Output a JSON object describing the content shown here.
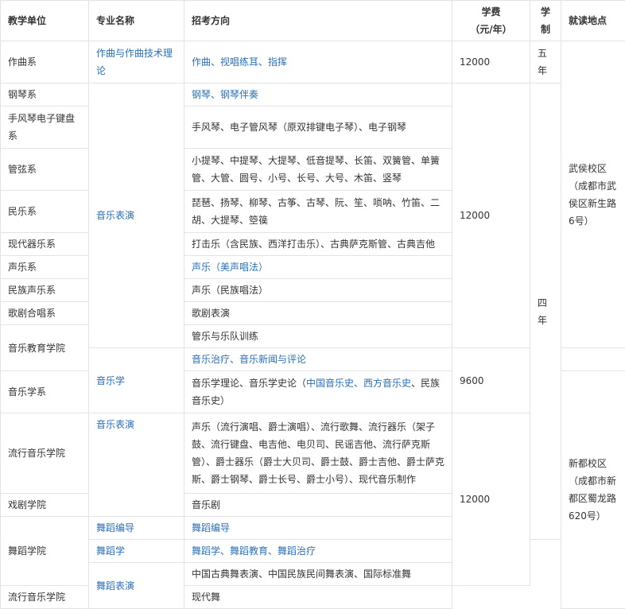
{
  "table": {
    "headers": {
      "unit": "教学单位",
      "major": "专业名称",
      "direction": "招考方向",
      "fee_line1": "学费",
      "fee_line2": "（元/年）",
      "duration_line1": "学",
      "duration_line2": "制",
      "location": "就读地点"
    },
    "units": {
      "composition": "作曲系",
      "piano": "钢琴系",
      "accordion": "手风琴电子键盘系",
      "orchestral": "管弦系",
      "folk": "民乐系",
      "modern_instruments": "现代器乐系",
      "vocal": "声乐系",
      "folk_vocal": "民族声乐系",
      "opera_chorus": "歌剧合唱系",
      "music_education": "音乐教育学院",
      "musicology": "音乐学系",
      "pop_music_1": "流行音乐学院",
      "drama": "戏剧学院",
      "dance": "舞蹈学院",
      "pop_music_2": "流行音乐学院"
    },
    "majors": {
      "composition_theory": "作曲与作曲技术理论",
      "performance_1": "音乐表演",
      "musicology": "音乐学",
      "performance_2": "音乐表演",
      "choreography": "舞蹈编导",
      "dance_studies": "舞蹈学",
      "dance_performance": "舞蹈表演"
    },
    "directions": {
      "composition": "作曲、视唱练耳、指挥",
      "piano": "钢琴、钢琴伴奏",
      "accordion": "手风琴、电子管风琴（原双排键电子琴）、电子钢琴",
      "orchestral": "小提琴、中提琴、大提琴、低音提琴、长笛、双簧管、单簧管、大管、圆号、小号、长号、大号、木笛、竖琴",
      "folk": "琵琶、扬琴、柳琴、古筝、古琴、阮、笙、唢呐、竹笛、二胡、大提琴、箜篌",
      "modern_instruments": "打击乐（含民族、西洋打击乐）、古典萨克斯管、古典吉他",
      "vocal": "声乐（美声唱法）",
      "folk_vocal": "声乐（民族唱法）",
      "opera": "歌剧表演",
      "band_training": "管乐与乐队训练",
      "therapy_news": "音乐治疗、音乐新闻与评论",
      "musicology_prefix": "音乐学理论、音乐学史论（",
      "musicology_link": "中国音乐史、西方音乐史",
      "musicology_suffix": "、民族音乐史）",
      "pop_music": "声乐（流行演唱、爵士演唱）、流行歌舞、流行器乐（架子鼓、流行键盘、电吉他、电贝司、民谣吉他、流行萨克斯管）、爵士器乐（爵士大贝司、爵士鼓、爵士吉他、爵士萨克斯、爵士钢琴、爵士长号、爵士小号）、现代音乐制作",
      "musical": "音乐剧",
      "choreography": "舞蹈编导",
      "dance_studies": "舞蹈学、舞蹈教育、舞蹈治疗",
      "dance_performance": "中国古典舞表演、中国民族民间舞表演、国际标准舞",
      "modern_dance": "现代舞"
    },
    "fees": {
      "composition": "12000",
      "performance": "12000",
      "musicology": "9600",
      "other": "12000"
    },
    "durations": {
      "five": "五年",
      "four": "四年"
    },
    "locations": {
      "wuhou": "武侯校区（成都市武侯区新生路6号）",
      "xindu": "新都校区（成都市新都区蜀龙路620号）"
    }
  },
  "colors": {
    "link": "#2a6fb7",
    "text": "#333333",
    "border": "#e3e3e3"
  }
}
